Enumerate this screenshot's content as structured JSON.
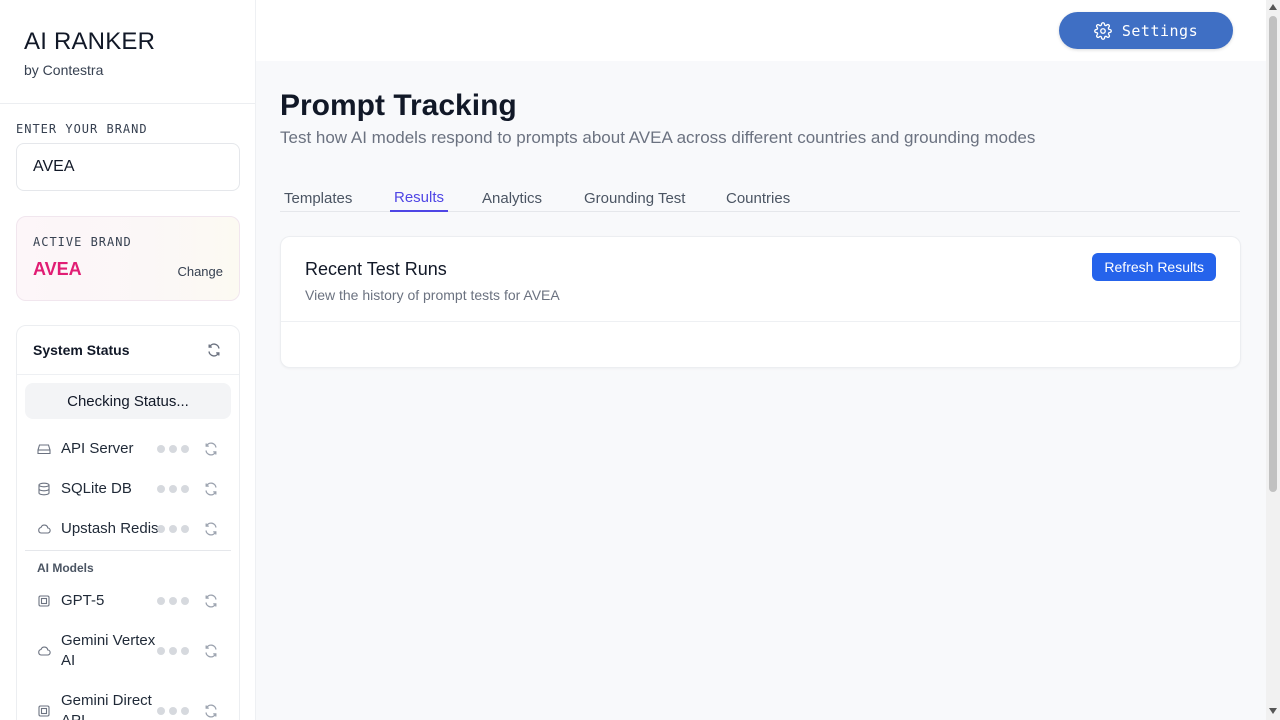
{
  "sidebar": {
    "app_title": "AI RANKER",
    "app_subtitle": "by Contestra",
    "enter_brand_label": "ENTER YOUR BRAND",
    "brand_input_value": "AVEA",
    "active_brand_label": "ACTIVE BRAND",
    "active_brand_name": "AVEA",
    "change_label": "Change",
    "system_status": {
      "title": "System Status",
      "checking_label": "Checking Status...",
      "services": [
        {
          "label": "API Server",
          "icon": "server-icon"
        },
        {
          "label": "SQLite DB",
          "icon": "database-icon"
        },
        {
          "label": "Upstash Redis",
          "icon": "cloud-icon"
        }
      ],
      "models_label": "AI Models",
      "models": [
        {
          "label": "GPT-5",
          "icon": "chip-icon"
        },
        {
          "label": "Gemini Vertex AI",
          "icon": "cloud-icon"
        },
        {
          "label": "Gemini Direct API",
          "icon": "chip-icon"
        }
      ]
    }
  },
  "header": {
    "settings_label": "Settings",
    "settings_icon": "gear-icon"
  },
  "main": {
    "title": "Prompt Tracking",
    "subtitle": "Test how AI models respond to prompts about AVEA across different countries and grounding modes",
    "tabs": [
      {
        "label": "Templates",
        "active": false
      },
      {
        "label": "Results",
        "active": true
      },
      {
        "label": "Analytics",
        "active": false
      },
      {
        "label": "Grounding Test",
        "active": false
      },
      {
        "label": "Countries",
        "active": false
      }
    ],
    "runs_card": {
      "title": "Recent Test Runs",
      "subtitle": "View the history of prompt tests for AVEA",
      "refresh_label": "Refresh Results"
    }
  },
  "colors": {
    "accent": "#4f46e5",
    "primary_button": "#2563eb",
    "settings_button": "#3f6fc4",
    "brand_pink": "#e11d74"
  }
}
